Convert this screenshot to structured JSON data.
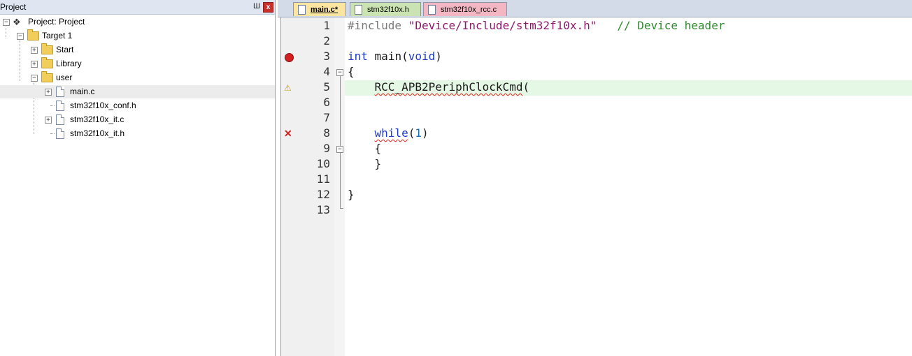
{
  "project_pane": {
    "title": "Project",
    "pin_glyph": "Ш",
    "close_glyph": "x",
    "tree": {
      "root": "Project: Project",
      "target": "Target 1",
      "groups": [
        "Start",
        "Library",
        "user"
      ],
      "files": [
        "main.c",
        "stm32f10x_conf.h",
        "stm32f10x_it.c",
        "stm32f10x_it.h"
      ],
      "expand_glyph": "+",
      "collapse_glyph": "−"
    }
  },
  "editor": {
    "tabs": [
      {
        "label": "main.c*",
        "active": true,
        "color": "#fbe59f"
      },
      {
        "label": "stm32f10x.h",
        "active": false,
        "color": "#cbe3b3"
      },
      {
        "label": "stm32f10x_rcc.c",
        "active": false,
        "color": "#f2b7c3"
      }
    ],
    "line_numbers": [
      "1",
      "2",
      "3",
      "4",
      "5",
      "6",
      "7",
      "8",
      "9",
      "10",
      "11",
      "12",
      "13"
    ],
    "code": {
      "l1_include": "#include",
      "l1_path": "\"Device/Include/stm32f10x.h\"",
      "l1_comment": "// Device header",
      "l3_int": "int",
      "l3_main": " main(",
      "l3_void": "void",
      "l3_close": ")",
      "l4_brace": "{",
      "l5_call": "RCC_APB2PeriphClockCmd",
      "l5_paren": "(",
      "l8_while": "while",
      "l8_open": "(",
      "l8_num": "1",
      "l8_close": ")",
      "l9_brace": "{",
      "l10_brace": "}",
      "l12_brace": "}"
    },
    "markers": {
      "breakpoint_line": "3",
      "warning_line": "5",
      "error_line": "8",
      "warning_glyph": "⚠",
      "error_glyph": "✕"
    },
    "fold_glyph": "−",
    "current_line": "5",
    "colors": {
      "keyword": "#1d3acc",
      "string": "#8b1a6b",
      "comment": "#2f8a2f",
      "current_line_bg": "#e5f7e5"
    }
  }
}
